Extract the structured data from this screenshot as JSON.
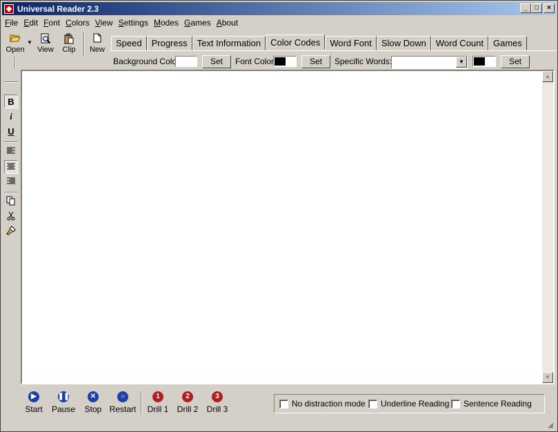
{
  "window": {
    "title": "Universal Reader 2.3",
    "controls": {
      "minimize": "_",
      "maximize": "□",
      "close": "×"
    }
  },
  "menu": [
    {
      "label": "File",
      "u": "F",
      "rest": "ile"
    },
    {
      "label": "Edit",
      "u": "E",
      "rest": "dit"
    },
    {
      "label": "Font",
      "u": "F",
      "rest": "ont"
    },
    {
      "label": "Colors",
      "u": "C",
      "rest": "olors"
    },
    {
      "label": "View",
      "u": "V",
      "rest": "iew"
    },
    {
      "label": "Settings",
      "u": "S",
      "rest": "ettings"
    },
    {
      "label": "Modes",
      "u": "M",
      "rest": "odes"
    },
    {
      "label": "Games",
      "u": "G",
      "rest": "ames"
    },
    {
      "label": "About",
      "u": "A",
      "rest": "bout"
    }
  ],
  "toolbar": {
    "open": "Open",
    "view": "View",
    "clip": "Clip",
    "new": "New"
  },
  "tabs": [
    "Speed",
    "Progress",
    "Text Information",
    "Color Codes",
    "Word Font",
    "Slow Down",
    "Word Count",
    "Games"
  ],
  "active_tab": "Color Codes",
  "color_codes": {
    "background_label": "Background Color:",
    "font_label": "Font Color:",
    "specific_label": "Specific Words:",
    "set_label": "Set",
    "specific_value": "",
    "background_color": "#ffffff",
    "font_color": "#000000",
    "specific_color": "#000000"
  },
  "format": {
    "bold": "B",
    "italic": "i",
    "underline": "U"
  },
  "controls": {
    "start": "Start",
    "pause": "Pause",
    "stop": "Stop",
    "restart": "Restart",
    "drill1": "Drill 1",
    "drill2": "Drill 2",
    "drill3": "Drill 3",
    "drill1_num": "1",
    "drill2_num": "2",
    "drill3_num": "3",
    "blue": "#1c3fa8",
    "red": "#b02020"
  },
  "options": {
    "no_distraction": "No distraction mode",
    "underline_reading": "Underline Reading",
    "sentence_reading": "Sentence Reading",
    "no_distraction_checked": false,
    "underline_reading_checked": false,
    "sentence_reading_checked": false
  }
}
